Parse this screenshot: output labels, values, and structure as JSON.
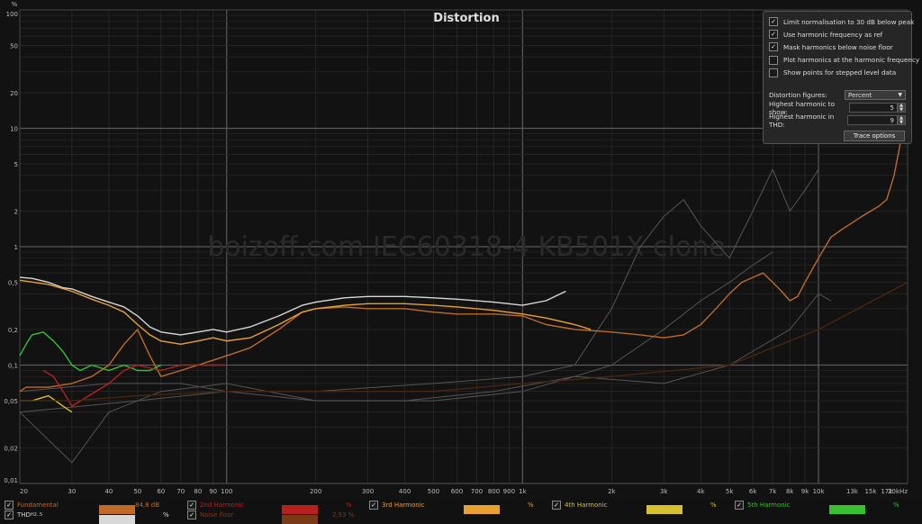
{
  "chart_data": {
    "type": "line",
    "title": "Distortion",
    "xlabel": "",
    "ylabel": "%",
    "x_scale": "log",
    "y_scale": "log",
    "xlim": [
      20,
      20000
    ],
    "ylim": [
      0.01,
      100
    ],
    "watermark": "boizoff.com IEC60318-4 KB501X clone",
    "x_tick_labels": [
      {
        "v": 20,
        "t": "20"
      },
      {
        "v": 30,
        "t": "30"
      },
      {
        "v": 40,
        "t": "40"
      },
      {
        "v": 50,
        "t": "50"
      },
      {
        "v": 60,
        "t": "60"
      },
      {
        "v": 70,
        "t": "70"
      },
      {
        "v": 80,
        "t": "80"
      },
      {
        "v": 90,
        "t": "90"
      },
      {
        "v": 100,
        "t": "100"
      },
      {
        "v": 200,
        "t": "200"
      },
      {
        "v": 300,
        "t": "300"
      },
      {
        "v": 400,
        "t": "400"
      },
      {
        "v": 500,
        "t": "500"
      },
      {
        "v": 600,
        "t": "600"
      },
      {
        "v": 700,
        "t": "700"
      },
      {
        "v": 800,
        "t": "800"
      },
      {
        "v": 900,
        "t": "900"
      },
      {
        "v": 1000,
        "t": "1k"
      },
      {
        "v": 2000,
        "t": "2k"
      },
      {
        "v": 3000,
        "t": "3k"
      },
      {
        "v": 4000,
        "t": "4k"
      },
      {
        "v": 5000,
        "t": "5k"
      },
      {
        "v": 6000,
        "t": "6k"
      },
      {
        "v": 7000,
        "t": "7k"
      },
      {
        "v": 8000,
        "t": "8k"
      },
      {
        "v": 9000,
        "t": "9k"
      },
      {
        "v": 10000,
        "t": "10k"
      },
      {
        "v": 13000,
        "t": "13k"
      },
      {
        "v": 15000,
        "t": "15k"
      },
      {
        "v": 17000,
        "t": "17k"
      },
      {
        "v": 20000,
        "t": "20kHz"
      }
    ],
    "y_tick_labels": [
      {
        "v": 100,
        "t": "100"
      },
      {
        "v": 50,
        "t": "50"
      },
      {
        "v": 20,
        "t": "20"
      },
      {
        "v": 10,
        "t": "10"
      },
      {
        "v": 5,
        "t": "5"
      },
      {
        "v": 2,
        "t": "2"
      },
      {
        "v": 1,
        "t": "1"
      },
      {
        "v": 0.5,
        "t": "0,5"
      },
      {
        "v": 0.2,
        "t": "0,2"
      },
      {
        "v": 0.1,
        "t": "0,1"
      },
      {
        "v": 0.05,
        "t": "0,05"
      },
      {
        "v": 0.02,
        "t": "0,02"
      },
      {
        "v": 0.01,
        "t": "0,01"
      }
    ],
    "series": [
      {
        "name": "THD",
        "color": "#d8d8d8",
        "x": [
          20,
          22,
          25,
          28,
          30,
          35,
          40,
          45,
          50,
          55,
          60,
          70,
          80,
          90,
          100,
          120,
          150,
          180,
          200,
          250,
          300,
          400,
          500,
          600,
          800,
          1000,
          1200,
          1400
        ],
        "y": [
          0.55,
          0.54,
          0.5,
          0.45,
          0.44,
          0.38,
          0.34,
          0.31,
          0.26,
          0.21,
          0.19,
          0.18,
          0.19,
          0.2,
          0.19,
          0.21,
          0.26,
          0.32,
          0.34,
          0.37,
          0.38,
          0.38,
          0.37,
          0.36,
          0.34,
          0.32,
          0.35,
          0.42
        ]
      },
      {
        "name": "Fundamental",
        "color": "#c06a28",
        "x": [
          20,
          21,
          25,
          30,
          35,
          40,
          45,
          50,
          55,
          60,
          70,
          80,
          90,
          100,
          120,
          150,
          180,
          200,
          250,
          300,
          400,
          500,
          600,
          800,
          1000,
          1200,
          1500,
          2000,
          2500,
          3000,
          3500,
          4000,
          4500,
          5000,
          5500,
          6000,
          6500,
          7000,
          7500,
          8000,
          8500,
          9000,
          10000,
          11000,
          12000,
          14000,
          16000,
          17000,
          18000,
          19000,
          20000
        ],
        "y": [
          0.06,
          0.065,
          0.065,
          0.07,
          0.08,
          0.1,
          0.15,
          0.2,
          0.12,
          0.08,
          0.09,
          0.1,
          0.11,
          0.12,
          0.14,
          0.2,
          0.28,
          0.3,
          0.31,
          0.3,
          0.3,
          0.28,
          0.27,
          0.27,
          0.26,
          0.22,
          0.2,
          0.19,
          0.18,
          0.17,
          0.18,
          0.22,
          0.3,
          0.4,
          0.5,
          0.55,
          0.6,
          0.5,
          0.42,
          0.35,
          0.38,
          0.5,
          0.8,
          1.2,
          1.4,
          1.8,
          2.2,
          2.5,
          4,
          8,
          10
        ]
      },
      {
        "name": "3rd Harmonic",
        "color": "#e8a030",
        "x": [
          20,
          25,
          30,
          35,
          40,
          45,
          50,
          55,
          60,
          70,
          80,
          90,
          100,
          120,
          150,
          180,
          200,
          250,
          300,
          400,
          500,
          600,
          800,
          1000,
          1200,
          1500,
          1700
        ],
        "y": [
          0.52,
          0.48,
          0.42,
          0.36,
          0.32,
          0.28,
          0.22,
          0.18,
          0.16,
          0.15,
          0.16,
          0.17,
          0.16,
          0.17,
          0.22,
          0.28,
          0.3,
          0.32,
          0.33,
          0.33,
          0.32,
          0.31,
          0.29,
          0.27,
          0.25,
          0.22,
          0.2
        ]
      },
      {
        "name": "4th Harmonic",
        "color": "#d4c030",
        "x": [
          20,
          22,
          25,
          28,
          30
        ],
        "y": [
          0.05,
          0.05,
          0.055,
          0.045,
          0.04
        ]
      },
      {
        "name": "5th Harmonic",
        "color": "#38c030",
        "x": [
          20,
          21,
          22,
          24,
          26,
          28,
          30,
          32,
          35,
          40,
          45,
          50,
          55,
          60
        ],
        "y": [
          0.12,
          0.15,
          0.18,
          0.19,
          0.16,
          0.13,
          0.1,
          0.09,
          0.1,
          0.09,
          0.1,
          0.09,
          0.09,
          0.1
        ]
      },
      {
        "name": "2nd Harmonic",
        "color": "#b82020",
        "x": [
          24,
          26,
          28,
          30,
          40,
          45,
          50,
          60,
          70,
          90,
          100
        ],
        "y": [
          0.09,
          0.08,
          0.06,
          0.045,
          0.07,
          0.09,
          0.1,
          0.09,
          0.1,
          0.1,
          0.1
        ]
      },
      {
        "name": "Noise floor",
        "color": "#4a2510",
        "x": [
          20,
          30,
          50,
          100,
          200,
          500,
          1000,
          2000,
          5000,
          10000,
          20000
        ],
        "y": [
          0.05,
          0.05,
          0.055,
          0.06,
          0.06,
          0.06,
          0.07,
          0.08,
          0.1,
          0.2,
          0.5
        ]
      },
      {
        "name": "",
        "color": "#555555",
        "x": [
          20,
          40,
          70,
          100,
          200,
          500,
          1000,
          1500,
          2000,
          2500,
          3000,
          3500,
          4000,
          5000,
          6000,
          7000,
          8000,
          9000,
          10000
        ],
        "y": [
          0.06,
          0.07,
          0.07,
          0.06,
          0.06,
          0.07,
          0.08,
          0.1,
          0.3,
          1.0,
          1.8,
          2.5,
          1.5,
          0.8,
          2.0,
          4.5,
          2.0,
          3.0,
          4.5
        ]
      },
      {
        "name": "",
        "color": "#555555",
        "x": [
          20,
          50,
          100,
          200,
          500,
          1000,
          1500,
          2000,
          3000,
          4000,
          5000,
          6000,
          7000
        ],
        "y": [
          0.04,
          0.05,
          0.06,
          0.05,
          0.05,
          0.06,
          0.08,
          0.1,
          0.2,
          0.35,
          0.5,
          0.7,
          0.9
        ]
      },
      {
        "name": "",
        "color": "#555555",
        "x": [
          20,
          30,
          40,
          60,
          100,
          200,
          400,
          800,
          1500,
          3000,
          5000,
          8000,
          10000,
          11000
        ],
        "y": [
          0.04,
          0.015,
          0.04,
          0.06,
          0.07,
          0.05,
          0.05,
          0.06,
          0.08,
          0.07,
          0.1,
          0.2,
          0.4,
          0.35
        ]
      }
    ]
  },
  "options_panel": {
    "checkboxes": [
      {
        "label": "Limit normalisation to 30 dB below peak",
        "checked": true,
        "mark": "✓"
      },
      {
        "label": "Use harmonic frequency as ref",
        "checked": true,
        "mark": "✓"
      },
      {
        "label": "Mask harmonics below noise floor",
        "checked": true,
        "mark": "✓"
      },
      {
        "label": "Plot harmonics at the harmonic frequency",
        "checked": false,
        "mark": ""
      },
      {
        "label": "Show points for stepped level data",
        "checked": false,
        "mark": ""
      }
    ],
    "distortion_figures_label": "Distortion figures:",
    "distortion_figures_value": "Percent",
    "highest_harmonic_show_label": "Highest harmonic to show:",
    "highest_harmonic_show_value": "5",
    "highest_harmonic_thd_label": "Highest harmonic in THD:",
    "highest_harmonic_thd_value": "9",
    "trace_options_label": "Trace options"
  },
  "legend": {
    "check_mark": "✓",
    "items": [
      {
        "label": "Fundamental",
        "value": "84,8 dB",
        "color": "#c06a28"
      },
      {
        "label": "2nd Harmonic",
        "value": "%",
        "color": "#b82020"
      },
      {
        "label": "3rd Harmonic",
        "value": "%",
        "color": "#e8a030"
      },
      {
        "label": "4th Harmonic",
        "value": "%",
        "color": "#d4c030"
      },
      {
        "label": "5th Harmonic",
        "value": "%",
        "color": "#38c030"
      },
      {
        "label": "THD",
        "sub": "H2..5",
        "value": "%",
        "color": "#d8d8d8"
      },
      {
        "label": "Noise floor",
        "value": "2,53 %",
        "color": "#7a3a18"
      }
    ]
  }
}
